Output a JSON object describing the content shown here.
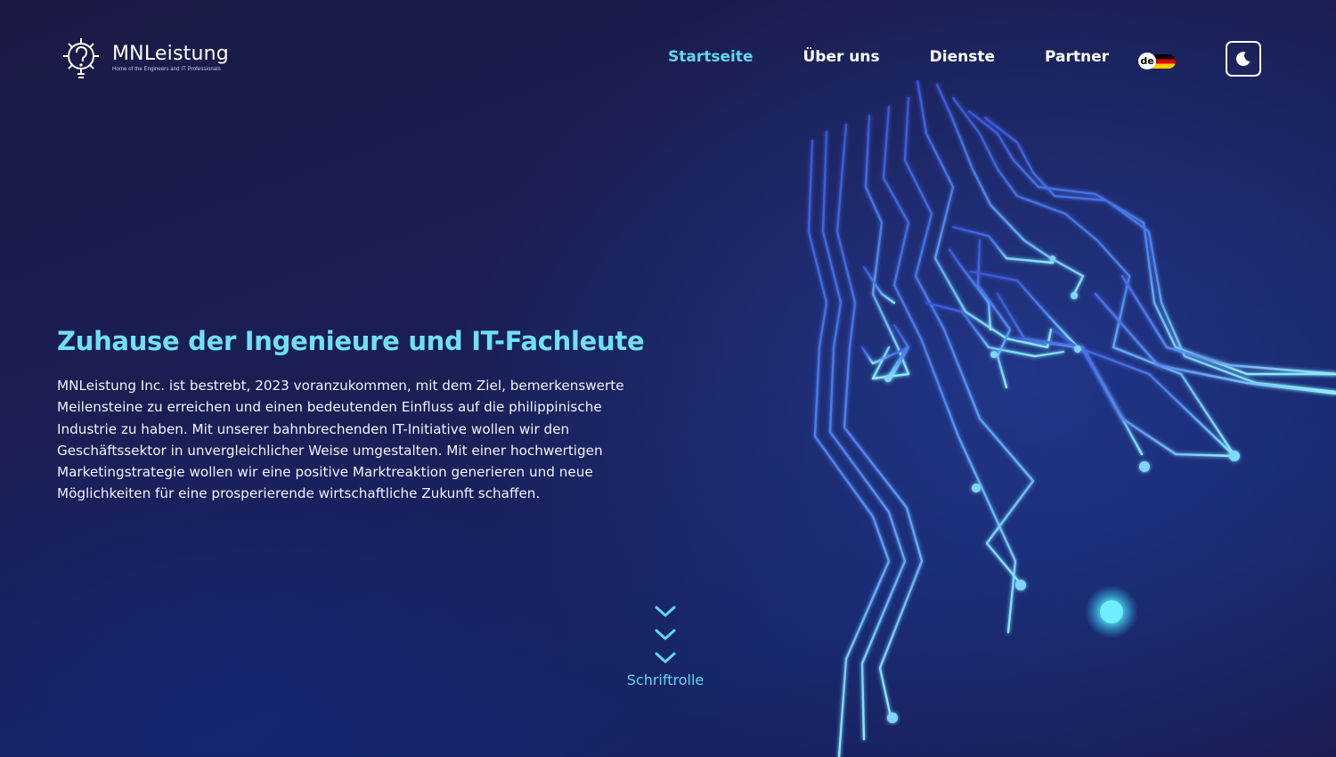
{
  "header": {
    "brand": {
      "name": "MNLeistung",
      "tagline": "Home of the Engineers and IT Professionals"
    },
    "nav": [
      {
        "label": "Startseite",
        "active": true
      },
      {
        "label": "Über uns",
        "active": false
      },
      {
        "label": "Dienste",
        "active": false
      },
      {
        "label": "Partner",
        "active": false
      }
    ],
    "language": {
      "code": "de",
      "flag_icon": "germany-flag-icon"
    },
    "theme_toggle": {
      "icon": "moon-icon"
    }
  },
  "hero": {
    "title": "Zuhause der Ingenieure und IT-Fachleute",
    "text": "MNLeistung Inc. ist bestrebt, 2023 voranzukommen, mit dem Ziel, bemerkenswerte Meilensteine zu erreichen und einen bedeutenden Einfluss auf die philippinische Industrie zu haben. Mit unserer bahnbrechenden IT-Initiative wollen wir den Geschäftssektor in unvergleichlicher Weise umgestalten. Mit einer hochwertigen Marketingstrategie wollen wir eine positive Marktreaktion generieren und neue Möglichkeiten für eine prosperierende wirtschaftliche Zukunft schaffen."
  },
  "scroll": {
    "label": "Schriftrolle",
    "icon": "chevron-down-icon"
  },
  "colors": {
    "accent": "#5fd8f2",
    "background": "#1a1f55",
    "text": "#ffffff",
    "circuit_dark": "#3f63e0",
    "circuit_light": "#7be9ff"
  }
}
